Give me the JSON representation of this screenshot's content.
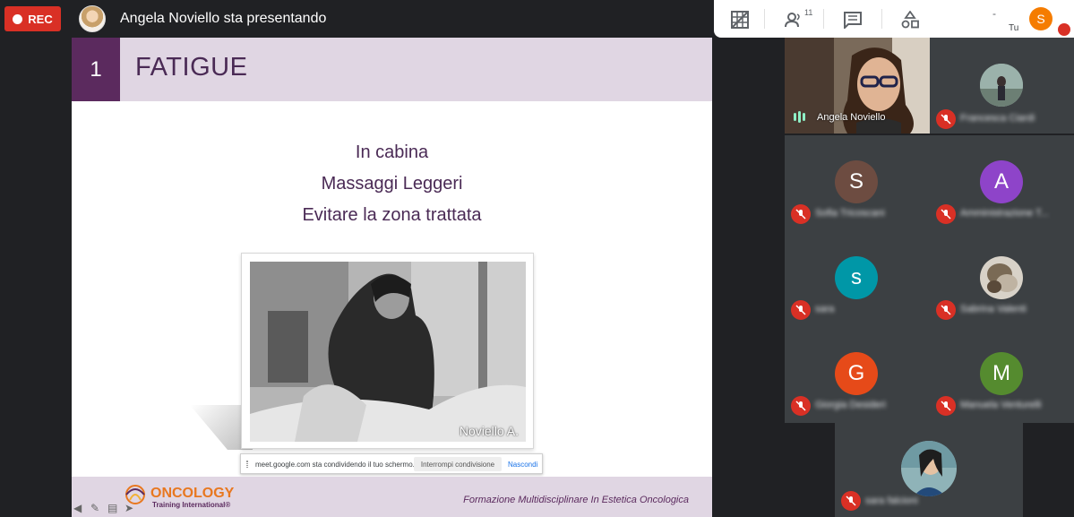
{
  "rec_label": "REC",
  "presenter_text": "Angela Noviello sta presentando",
  "toolbar": {
    "people_count": "11",
    "tu_dash": "-",
    "tu_label": "Tu",
    "self_initial": "S"
  },
  "slide": {
    "number": "1",
    "title": "FATIGUE",
    "lines": [
      "In cabina",
      "Massaggi Leggeri",
      "Evitare la zona trattata"
    ],
    "photo_caption": "Noviello A.",
    "footer_text": "Formazione Multidisciplinare In Estetica Oncologica",
    "logo_line1": "ONCOLOGY",
    "logo_line2": "Training International®"
  },
  "share_bar": {
    "text": "meet.google.com sta condividendo il tuo schermo.",
    "stop_label": "Interrompi condivisione",
    "hide_label": "Nascondi"
  },
  "participants": [
    {
      "name": "Angela Noviello",
      "speaking": true
    },
    {
      "name": "Francesca Ciardi",
      "muted": true
    },
    {
      "name": "Sofia Tricoscani",
      "initial": "S",
      "color": "#6d4c41",
      "muted": true
    },
    {
      "name": "Amministrazione T...",
      "initial": "A",
      "color": "#8e44c9",
      "muted": true
    },
    {
      "name": "sara",
      "initial": "s",
      "color": "#0097a7",
      "muted": true
    },
    {
      "name": "Sabrina Valenti",
      "muted": true
    },
    {
      "name": "Giorgia Desideri",
      "initial": "G",
      "color": "#e64a19",
      "muted": true
    },
    {
      "name": "Manuela Venturelli",
      "initial": "M",
      "color": "#558b2f",
      "muted": true
    },
    {
      "name": "sara falcioni",
      "muted": true
    }
  ],
  "colors": {
    "rec": "#d93025",
    "slide_header": "#e0d6e3",
    "slide_accent": "#5b2a5e",
    "logo_orange": "#e8771f"
  }
}
